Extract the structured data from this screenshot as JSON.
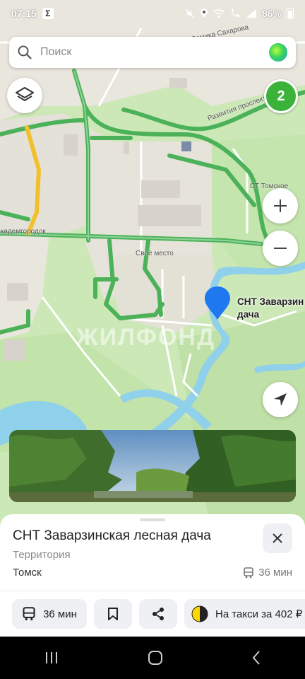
{
  "status": {
    "time": "07:15",
    "app_badge": "Σ",
    "battery": "86%"
  },
  "search": {
    "placeholder": "Поиск"
  },
  "map": {
    "badge_count": "2",
    "labels": {
      "street_top": "Демика Сахарова",
      "street_prospect": "Развития проспект",
      "st_tomskoe": "СТ Томское",
      "academgorodok": "Академгородок",
      "svoe_mesto": "Своё место"
    },
    "pin_label_line1": "СНТ Заварзин",
    "pin_label_line2": "дача",
    "watermark": "ЖИЛФОНД",
    "colors": {
      "water": "#8fd0ea",
      "forest": "#bfe3a8",
      "land": "#e9e6de",
      "traffic_road": "#4cb25a",
      "pin": "#1e78f0"
    }
  },
  "card": {
    "title": "СНТ Заварзинская лесная дача",
    "subtitle": "Территория",
    "city": "Томск",
    "eta": "36 мин"
  },
  "actions": {
    "route": "36 мин",
    "taxi": "На такси за 402 ₽"
  }
}
